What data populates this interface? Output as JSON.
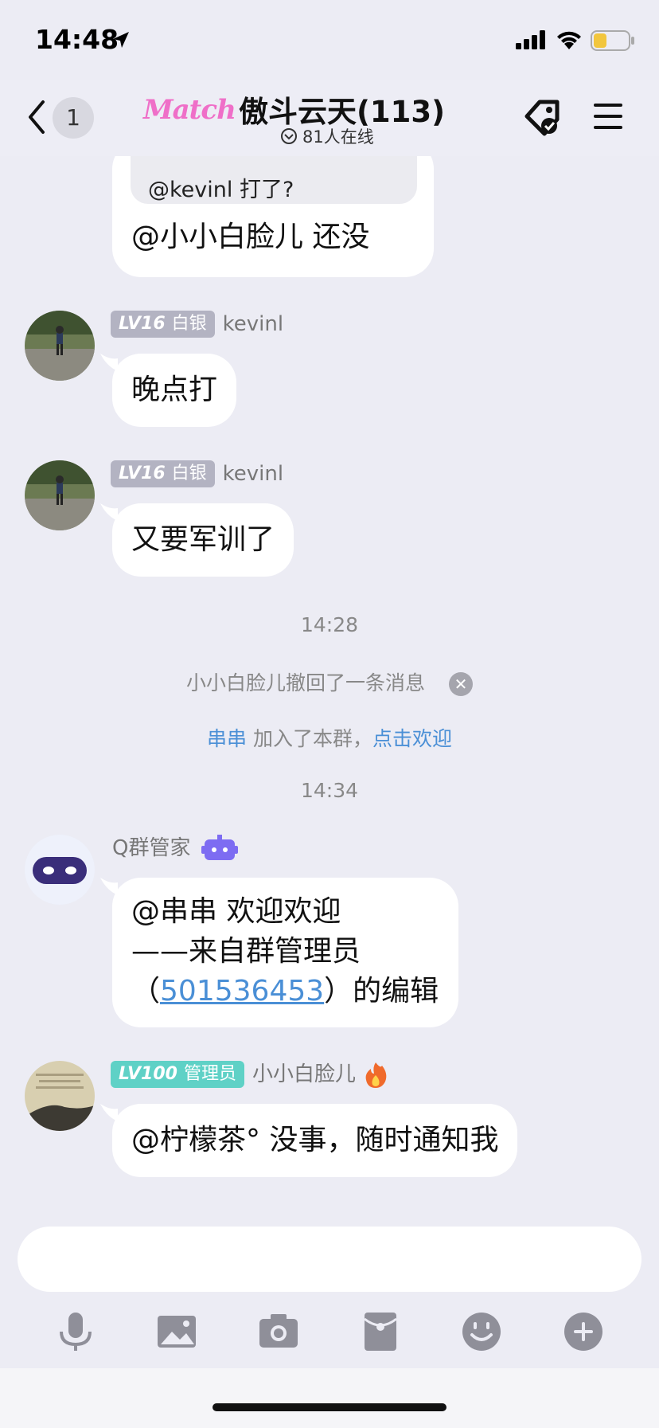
{
  "status_bar": {
    "time": "14:48"
  },
  "header": {
    "unread_count": "1",
    "logo_text": "Match",
    "title": "傲斗云天(113)",
    "online_text": "81人在线"
  },
  "messages": {
    "m1": {
      "quote": "@kevinl 打了?",
      "text": "@小小白脸儿 还没"
    },
    "m2": {
      "level": "LV16",
      "rank": "白银",
      "sender": "kevinl",
      "text": "晚点打"
    },
    "m3": {
      "level": "LV16",
      "rank": "白银",
      "sender": "kevinl",
      "text": "又要军训了"
    },
    "time1": "14:28",
    "recall": "小小白脸儿撤回了一条消息",
    "join": {
      "name": "串串",
      "text": " 加入了本群，",
      "action": "点击欢迎"
    },
    "time2": "14:34",
    "m4": {
      "sender": "Q群管家",
      "line1": "@串串 欢迎欢迎",
      "line2": "——来自群管理员",
      "line3_prefix": "（",
      "line3_link": "501536453",
      "line3_suffix": "）的编辑"
    },
    "m5": {
      "level": "LV100",
      "rank": "管理员",
      "sender": "小小白脸儿",
      "text": "@柠檬茶° 没事，随时通知我"
    }
  },
  "input": {
    "placeholder": ""
  },
  "colors": {
    "background": "#ececf4",
    "bubble": "#ffffff",
    "link": "#4a8fd6",
    "silver_badge": "#b3b3c2",
    "admin_badge": "#5fd1c6",
    "logo": "#ef6fc8",
    "bot_accent": "#7d6cf2"
  },
  "icons": {
    "tools": [
      "microphone-icon",
      "image-icon",
      "camera-icon",
      "red-packet-icon",
      "emoji-icon",
      "plus-icon"
    ]
  }
}
